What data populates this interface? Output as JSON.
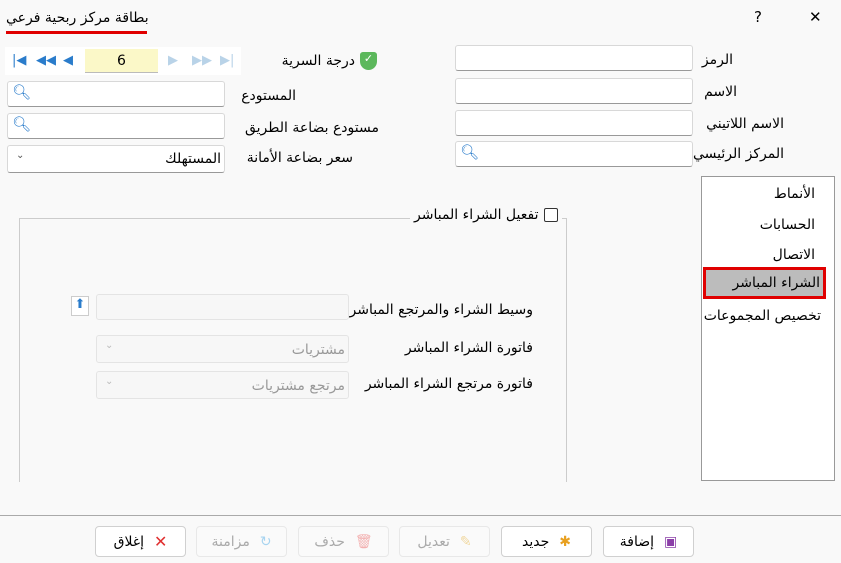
{
  "window": {
    "title": "بطاقة مركز ربحية فرعي",
    "help": "?",
    "close": "✕"
  },
  "form": {
    "code_label": "الرمز",
    "name_label": "الاسم",
    "latin_name_label": "الاسم اللاتيني",
    "main_center_label": "المركز الرئيسي",
    "security_label": "درجة السرية",
    "warehouse_label": "المستودع",
    "transit_warehouse_label": "مستودع بضاعة الطريق",
    "consignment_price_label": "سعر بضاعة الأمانة",
    "consignment_price_value": "المستهلك",
    "record_number": "6"
  },
  "tabs": {
    "items": [
      {
        "label": "الأنماط"
      },
      {
        "label": "الحسابات"
      },
      {
        "label": "الاتصال"
      },
      {
        "label": "الشراء المباشر"
      },
      {
        "label": "تخصيص المجموعات"
      }
    ],
    "selected": 3
  },
  "direct_purchase": {
    "enable_label": "تفعيل الشراء المباشر",
    "enabled": false,
    "intermediary_label": "وسيط الشراء والمرتجع المباشر",
    "invoice_label": "فاتورة الشراء المباشر",
    "invoice_value": "مشتريات",
    "return_label": "فاتورة مرتجع الشراء المباشر",
    "return_value": "مرتجع مشتريات"
  },
  "buttons": {
    "add": "إضافة",
    "new": "جديد",
    "edit": "تعديل",
    "delete": "حذف",
    "sync": "مزامنة",
    "close": "إغلاق"
  },
  "colors": {
    "accent": "#2a7ccb",
    "highlight": "#e00000",
    "record_bg": "#fbf8c8"
  }
}
